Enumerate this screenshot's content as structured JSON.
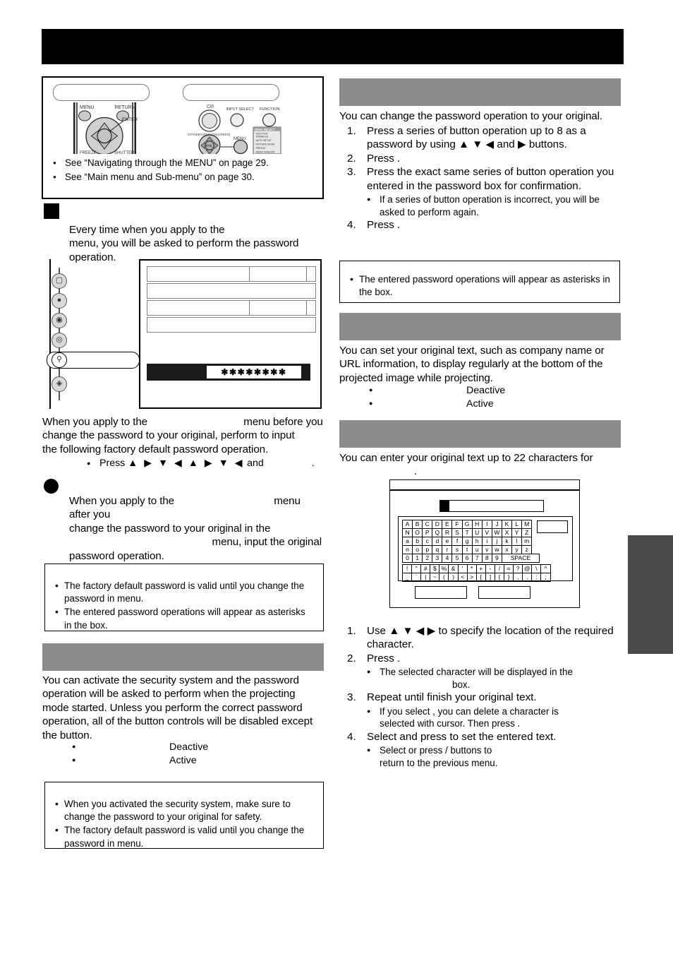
{
  "page": {
    "header_title": "",
    "side_tab_label": ""
  },
  "remote_panel": {
    "callout_left_label": "",
    "callout_right_label": "",
    "remote_buttons": {
      "menu": "MENU",
      "return": "RETURN",
      "enter": "ENTER",
      "freeze": "FREEZE",
      "shutter": "SHUTTER"
    },
    "projector_buttons": {
      "power": "⏻/I",
      "standby_lamp": "STANDBY(RED)/ON(GREEN)",
      "input_select": "INPUT SELECT",
      "function": "FUNCTION",
      "menu": "MENU",
      "rtb": "RTB"
    },
    "function_menu": {
      "title": "MENU SELECT",
      "items": [
        "SHUTTER",
        "DISABLED",
        "AUTO SETUP",
        "PICTURE MODE",
        "FREEZE",
        "INDEX WINDOW"
      ]
    },
    "see_also": [
      "See “Navigating through the MENU” on page 29.",
      "See “Main menu and Sub-menu” on page 30."
    ]
  },
  "left_column": {
    "section_a": {
      "heading": "",
      "intro_line1": "Every time when you apply to the",
      "intro_line2": "menu, you will be asked to perform the password",
      "intro_line3": "operation."
    },
    "osd_menu": {
      "icon_count": 6,
      "selected_icon_index": 5,
      "password_mask": "✱✱✱✱✱✱✱✱",
      "rows": 4
    },
    "default_password": {
      "line1_pre": "When you apply to the",
      "line1_blank": "",
      "line1_post": "menu before you",
      "line2": "change the password to your original, perform to input",
      "line3": "the following factory default password operation.",
      "press_label": "Press",
      "key_sequence": "▲ ▶ ▼ ◀ ▲ ▶ ▼ ◀",
      "press_and": "and",
      "press_tail": "."
    },
    "original_password": {
      "heading": "",
      "line1_pre": "When you apply to the",
      "line1_post": "menu after you",
      "line2": "change the password to your original in the",
      "line3": "menu, input the original",
      "line4": "password operation."
    },
    "note_1": [
      "The factory default password is valid until you change the password in                                      menu.",
      "The entered password operations will appear as asterisks in the box."
    ],
    "section_b": {
      "heading": "",
      "body": "You can activate the security system and the password operation will be asked to perform when the projecting mode started. Unless you perform the correct password operation, all of the button controls will be disabled except the                      button.",
      "options": [
        {
          "label": "",
          "value": "Deactive"
        },
        {
          "label": "",
          "value": "Active"
        }
      ]
    },
    "note_2": [
      "When you activated the security system, make sure to change the password to your original for safety.",
      "The factory default password is valid until you change the password in                                      menu."
    ]
  },
  "right_column": {
    "section_password_change": {
      "heading": "",
      "intro": "You can change the password operation to your original.",
      "steps": [
        {
          "num": "1.",
          "text": "Press a series of button operation up to 8 as a password by using ▲ ▼ ◀ and ▶ buttons."
        },
        {
          "num": "2.",
          "text": "Press                    ."
        },
        {
          "num": "3.",
          "text": "Press the exact same series of button operation you entered in the             password box for confirmation."
        },
        {
          "num": "4.",
          "text": "Press                    ."
        }
      ],
      "step3_bullet": "If a series of button operation is incorrect, you will be asked to perform again."
    },
    "note_3": [
      "The entered password operations will appear as asterisks in the box."
    ],
    "section_text_display": {
      "heading": "",
      "body": "You can set your original text, such as company name or URL information, to display regularly at the bottom of the projected image while projecting.",
      "options": [
        {
          "label": "",
          "value": "Deactive"
        },
        {
          "label": "",
          "value": "Active"
        }
      ]
    },
    "section_text_change": {
      "heading": "",
      "intro_line1": "You can enter your original text up to 22 characters for",
      "intro_line2": "."
    },
    "char_grid": {
      "rows_alpha": [
        [
          "A",
          "B",
          "C",
          "D",
          "E",
          "F",
          "G",
          "H",
          "I",
          "J",
          "K",
          "L",
          "M"
        ],
        [
          "N",
          "O",
          "P",
          "Q",
          "R",
          "S",
          "T",
          "U",
          "V",
          "W",
          "X",
          "Y",
          "Z"
        ],
        [
          "a",
          "b",
          "c",
          "d",
          "e",
          "f",
          "g",
          "h",
          "i",
          "j",
          "k",
          "l",
          "m"
        ],
        [
          "n",
          "o",
          "p",
          "q",
          "r",
          "s",
          "t",
          "u",
          "v",
          "w",
          "x",
          "y",
          "z"
        ]
      ],
      "row_numbers": [
        "0",
        "1",
        "2",
        "3",
        "4",
        "5",
        "6",
        "7",
        "8",
        "9"
      ],
      "space_label": "SPACE",
      "rows_symbols": [
        [
          "!",
          "\"",
          "#",
          "$",
          "%",
          "&",
          "'",
          "*",
          "+",
          "-",
          "/",
          "=",
          "?",
          "@",
          "\\",
          "^"
        ],
        [
          "_",
          "`",
          "|",
          "~",
          "(",
          ")",
          "<",
          ">",
          "[",
          "]",
          "{",
          "}",
          ",",
          ".",
          ":",
          ";"
        ]
      ],
      "entry_value": "",
      "button_left_label": "",
      "button_right_label": "",
      "side_box_label": ""
    },
    "text_steps": [
      {
        "num": "1.",
        "text": "Use ▲ ▼ ◀ ▶ to specify the location of the required character."
      },
      {
        "num": "2.",
        "text": "Press                    ."
      },
      {
        "num": "3.",
        "text": "Repeat until finish your original text."
      },
      {
        "num": "4.",
        "text": "Select            and press                     to set the entered text."
      }
    ],
    "text_step2_bullet_line1": "The selected character will be displayed in the",
    "text_step2_bullet_line2": "box.",
    "text_step3_bullet_line1": "If you select                  , you can delete a character is",
    "text_step3_bullet_line2": "selected with cursor. Then press                   .",
    "text_step4_bullet_line1": "Select                     or press            /                    buttons to",
    "text_step4_bullet_line2": "return to the previous menu."
  }
}
